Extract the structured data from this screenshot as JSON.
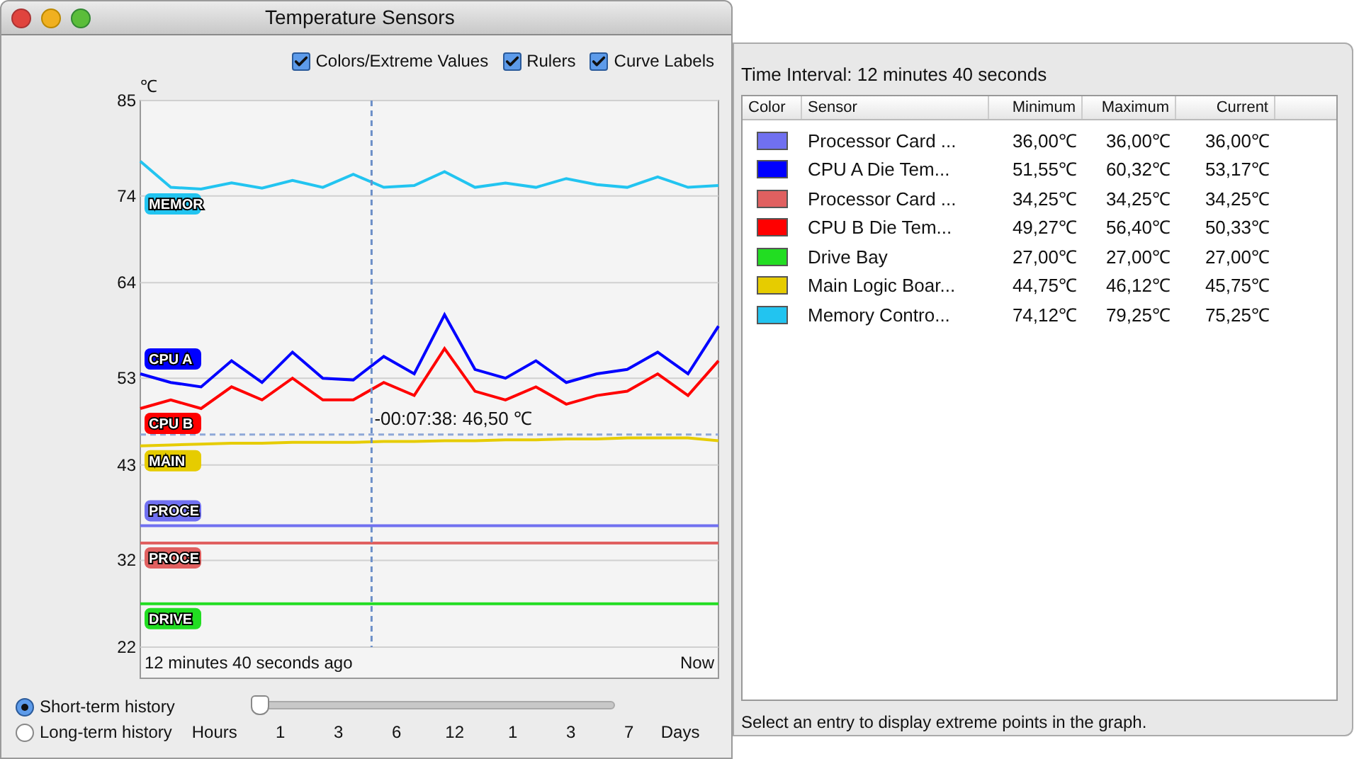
{
  "window": {
    "title": "Temperature Sensors"
  },
  "options": [
    {
      "label": "Colors/Extreme Values",
      "checked": true
    },
    {
      "label": "Rulers",
      "checked": true
    },
    {
      "label": "Curve Labels",
      "checked": true
    }
  ],
  "chart": {
    "unit": "℃",
    "start_label": "12 minutes 40 seconds ago",
    "end_label": "Now",
    "chart_data": {
      "type": "line",
      "categories": [
        null,
        null,
        null,
        null,
        null,
        null,
        null,
        null,
        null,
        null,
        null,
        null,
        null,
        null,
        null,
        null,
        null,
        null,
        null,
        null
      ],
      "ylim": [
        22,
        85
      ],
      "yticks": [
        22,
        32,
        43,
        53,
        64,
        74,
        85
      ],
      "grid": true,
      "series": [
        {
          "name": "PROCE",
          "color": "#7070f0",
          "values": [
            36,
            36,
            36,
            36,
            36,
            36,
            36,
            36,
            36,
            36,
            36,
            36,
            36,
            36,
            36,
            36,
            36,
            36,
            36,
            36
          ]
        },
        {
          "name": "CPU A",
          "color": "#0000ff",
          "values": [
            53.5,
            52.5,
            52,
            55,
            52.5,
            56,
            53,
            52.8,
            55.5,
            53.5,
            60.3,
            54,
            53,
            55,
            52.5,
            53.5,
            54,
            56,
            53.5,
            59
          ]
        },
        {
          "name": "PROCE",
          "color": "#e06060",
          "values": [
            34,
            34,
            34,
            34,
            34,
            34,
            34,
            34,
            34,
            34,
            34,
            34,
            34,
            34,
            34,
            34,
            34,
            34,
            34,
            34
          ]
        },
        {
          "name": "CPU B",
          "color": "#ff0000",
          "values": [
            49.5,
            50.5,
            49.5,
            52,
            50.5,
            53,
            50.5,
            50.5,
            52.5,
            51,
            56.4,
            51.5,
            50.5,
            52,
            50,
            51,
            51.5,
            53.5,
            51,
            55
          ]
        },
        {
          "name": "DRIVE",
          "color": "#22dd22",
          "values": [
            27,
            27,
            27,
            27,
            27,
            27,
            27,
            27,
            27,
            27,
            27,
            27,
            27,
            27,
            27,
            27,
            27,
            27,
            27,
            27
          ]
        },
        {
          "name": "MAIN",
          "color": "#e6cc00",
          "values": [
            45.2,
            45.3,
            45.4,
            45.5,
            45.5,
            45.6,
            45.6,
            45.6,
            45.7,
            45.7,
            45.8,
            45.8,
            45.9,
            45.9,
            46,
            46,
            46.1,
            46.1,
            46.1,
            45.8
          ]
        },
        {
          "name": "MEMOR",
          "color": "#22c4f0",
          "values": [
            78,
            75,
            74.8,
            75.5,
            74.9,
            75.8,
            75,
            76.5,
            75,
            75.2,
            76.8,
            75,
            75.5,
            75,
            76,
            75.3,
            75,
            76.2,
            75,
            75.2
          ]
        }
      ],
      "ref_lines": [
        {
          "axis": "y",
          "value": 46.5
        }
      ],
      "annotations": [
        {
          "y": 46.5,
          "text": "-00:07:38: 46,50 ℃"
        }
      ]
    }
  },
  "history": [
    {
      "label": "Short-term history",
      "selected": true
    },
    {
      "label": "Long-term history",
      "selected": false
    }
  ],
  "range_slider": {
    "level": 0,
    "start_unit": "Hours",
    "end_unit": "Days",
    "ticks": [
      "1",
      "3",
      "6",
      "12",
      "1",
      "3",
      "7"
    ]
  },
  "drawer": {
    "time_interval": "Time Interval: 12 minutes 40 seconds",
    "table": {
      "columns": [
        "Color",
        "Sensor",
        "Minimum",
        "Maximum",
        "Current"
      ],
      "rows": [
        {
          "color": "#7070f0",
          "sensor": "Processor Card ...",
          "minimum": "36,00℃",
          "maximum": "36,00℃",
          "current": "36,00℃"
        },
        {
          "color": "#0000ff",
          "sensor": "CPU A Die Tem...",
          "minimum": "51,55℃",
          "maximum": "60,32℃",
          "current": "53,17℃"
        },
        {
          "color": "#e06060",
          "sensor": "Processor Card ...",
          "minimum": "34,25℃",
          "maximum": "34,25℃",
          "current": "34,25℃"
        },
        {
          "color": "#ff0000",
          "sensor": "CPU B Die Tem...",
          "minimum": "49,27℃",
          "maximum": "56,40℃",
          "current": "50,33℃"
        },
        {
          "color": "#22dd22",
          "sensor": "Drive Bay",
          "minimum": "27,00℃",
          "maximum": "27,00℃",
          "current": "27,00℃"
        },
        {
          "color": "#e6cc00",
          "sensor": "Main Logic Boar...",
          "minimum": "44,75℃",
          "maximum": "46,12℃",
          "current": "45,75℃"
        },
        {
          "color": "#22c4f0",
          "sensor": "Memory Contro...",
          "minimum": "74,12℃",
          "maximum": "79,25℃",
          "current": "75,25℃"
        }
      ]
    },
    "status": "Select an entry to display extreme points in the graph."
  }
}
